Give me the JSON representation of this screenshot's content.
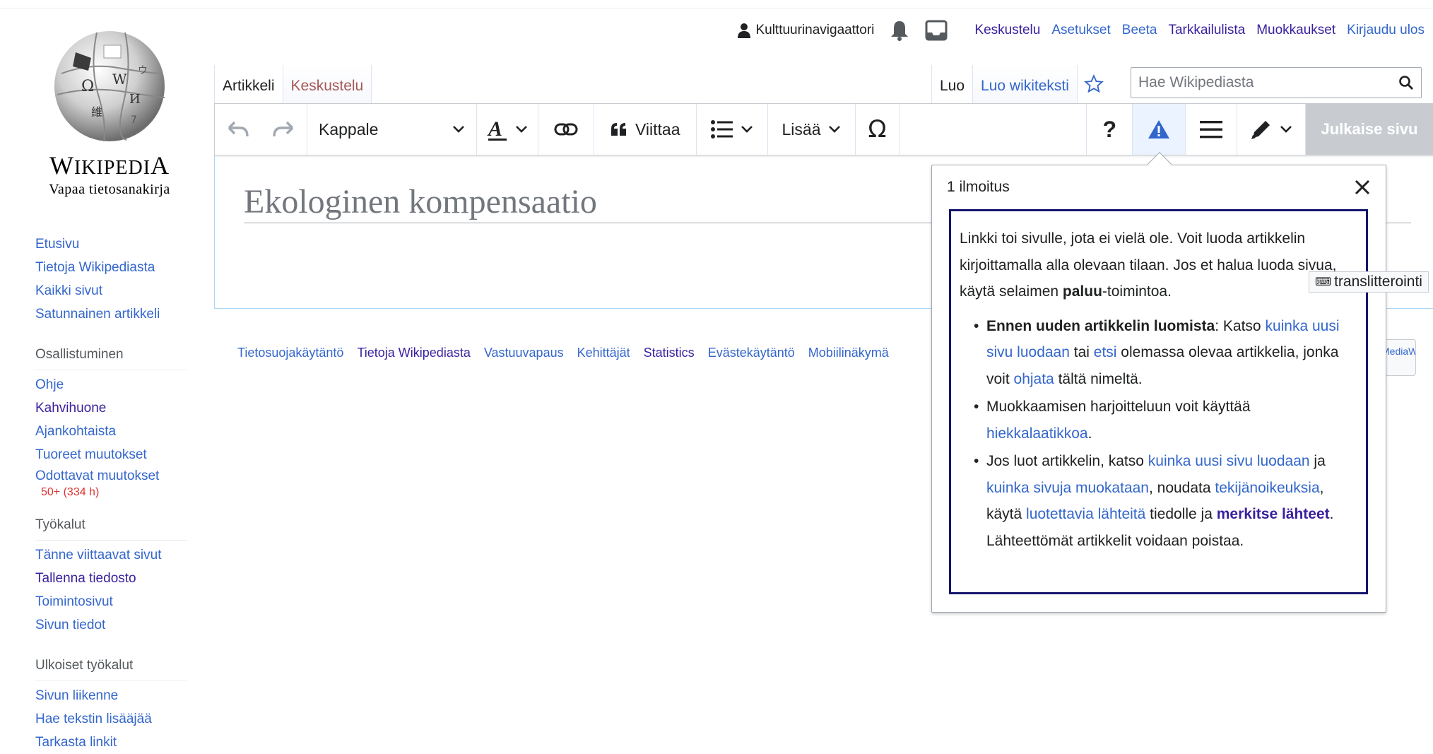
{
  "logo": {
    "wordmark": "Wikipedia",
    "tagline": "Vapaa tietosanakirja"
  },
  "personal": {
    "username": "Kulttuurinavigaattori",
    "links": [
      "Keskustelu",
      "Asetukset",
      "Beeta",
      "Tarkkailulista",
      "Muokkaukset",
      "Kirjaudu ulos"
    ]
  },
  "tabs": {
    "article": "Artikkeli",
    "talk": "Keskustelu",
    "create": "Luo",
    "create_source": "Luo wikiteksti"
  },
  "search": {
    "placeholder": "Hae Wikipediasta"
  },
  "toolbar": {
    "format": "Kappale",
    "cite": "Viittaa",
    "more": "Lisää",
    "help": "?",
    "publish": "Julkaise sivu"
  },
  "page": {
    "title": "Ekologinen kompensaatio"
  },
  "sidebar": {
    "nav": [
      "Etusivu",
      "Tietoja Wikipediasta",
      "Kaikki sivut",
      "Satunnainen artikkeli"
    ],
    "participation_heading": "Osallistuminen",
    "participation": [
      "Ohje",
      "Kahvihuone",
      "Ajankohtaista",
      "Tuoreet muutokset",
      "Odottavat muutokset"
    ],
    "pending_badge": "50+ (334 h)",
    "tools_heading": "Työkalut",
    "tools": [
      "Tänne viittaavat sivut",
      "Tallenna tiedosto",
      "Toimintosivut",
      "Sivun tiedot"
    ],
    "external_heading": "Ulkoiset työkalut",
    "external": [
      "Sivun liikenne",
      "Hae tekstin lisääjää",
      "Tarkasta linkit"
    ]
  },
  "footer": {
    "links": [
      "Tietosuojakäytäntö",
      "Tietoja Wikipediasta",
      "Vastuuvapaus",
      "Kehittäjät",
      "Statistics",
      "Evästekäytäntö",
      "Mobiilinäkymä"
    ],
    "powered": "MediaWiki"
  },
  "popup": {
    "header": "1 ilmoitus",
    "intro_1": "Linkki toi sivulle, jota ei vielä ole. Voit luoda artikkelin kirjoittamalla alla olevaan tilaan. Jos et halua luoda sivua, käytä selaimen ",
    "intro_bold": "paluu",
    "intro_2": "-toimintoa.",
    "b1_bold": "Ennen uuden artikkelin luomista",
    "b1_t1": ": Katso ",
    "b1_l1": "kuinka uusi sivu luodaan",
    "b1_t2": " tai ",
    "b1_l2": "etsi",
    "b1_t3": " olemassa olevaa artikkelia, jonka voit ",
    "b1_l3": "ohjata",
    "b1_t4": " tältä nimeltä.",
    "b2_t1": "Muokkaamisen harjoitteluun voit käyttää ",
    "b2_l1": "hiekkalaatikkoa",
    "b2_t2": ".",
    "b3_t1": "Jos luot artikkelin, katso ",
    "b3_l1": "kuinka uusi sivu luodaan",
    "b3_t2": " ja ",
    "b3_l2": "kuinka sivuja muokataan",
    "b3_t3": ", noudata ",
    "b3_l3": "tekijänoikeuksia",
    "b3_t4": ", käytä ",
    "b3_l4": "luotettavia lähteitä",
    "b3_t5": " tiedolle ja ",
    "b3_l5": "merkitse lähteet",
    "b3_t6": ". Lähteettömät artikkelit voidaan poistaa."
  },
  "translit": {
    "label": "translitterointi"
  }
}
